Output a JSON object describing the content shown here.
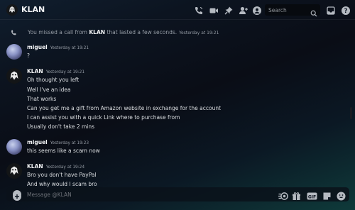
{
  "header": {
    "title": "KLAN",
    "search_placeholder": "Search"
  },
  "system": {
    "prefix": "You missed a call from",
    "name": "KLAN",
    "suffix": "that lasted a few seconds.",
    "timestamp": "Yesterday at 19:21"
  },
  "messages": [
    {
      "author": "miguel",
      "timestamp": "Yesterday at 19:21",
      "lines": [
        "?"
      ]
    },
    {
      "author": "KLAN",
      "timestamp": "Yesterday at 19:21",
      "lines": [
        "Oh thought you left",
        "Well I've an idea",
        "That works",
        "Can you get me a gift from Amazon website in exchange for the account",
        "I can assist you with a quick Link where to purchase from",
        "Usually don't take 2 mins"
      ]
    },
    {
      "author": "miguel",
      "timestamp": "Yesterday at 19:23",
      "lines": [
        "this seems like a scam now"
      ]
    },
    {
      "author": "KLAN",
      "timestamp": "Yesterday at 19:24",
      "lines": [
        "Bro you don't have PayPal",
        "And why would I scam bro"
      ]
    }
  ],
  "composer": {
    "placeholder": "Message @KLAN",
    "gif_label": "GIF"
  },
  "icons": {
    "header": [
      "call-icon",
      "video-icon",
      "pin-icon",
      "add-friend-icon",
      "user-profile-icon",
      "search-icon",
      "inbox-icon",
      "help-icon"
    ],
    "composer": [
      "add-attachment-icon",
      "nitro-gift-icon",
      "gift-icon",
      "gif-icon",
      "sticker-icon",
      "emoji-icon"
    ]
  },
  "colors": {
    "text_primary": "#f2f3f5",
    "text_muted": "#949ba4",
    "icon": "#b5bac1"
  }
}
